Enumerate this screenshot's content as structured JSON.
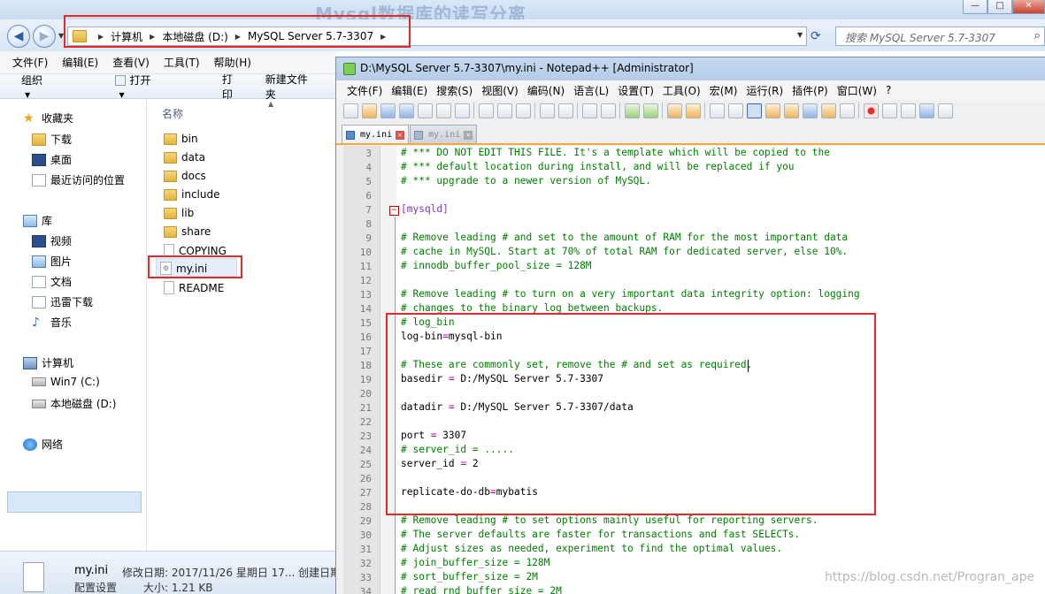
{
  "explorer": {
    "bg_title": "Mysql数据库的读写分离",
    "window_buttons": [
      "—",
      "□",
      "✕"
    ],
    "back_icon": "◀",
    "forward_icon": "▶",
    "breadcrumb": [
      "计算机",
      "本地磁盘 (D:)",
      "MySQL Server 5.7-3307"
    ],
    "search_placeholder": "搜索 MySQL Server 5.7-3307",
    "menu": [
      "文件(F)",
      "编辑(E)",
      "查看(V)",
      "工具(T)",
      "帮助(H)"
    ],
    "commands": [
      "组织",
      "打开",
      "打印",
      "新建文件夹"
    ],
    "nav": {
      "favorites": "收藏夹",
      "fav_items": [
        "下载",
        "桌面",
        "最近访问的位置"
      ],
      "library": "库",
      "lib_items": [
        "视频",
        "图片",
        "文档",
        "迅雷下载",
        "音乐"
      ],
      "computer": "计算机",
      "comp_items": [
        "Win7 (C:)",
        "本地磁盘 (D:)"
      ],
      "network": "网络"
    },
    "column_header": "名称",
    "folders": [
      "bin",
      "data",
      "docs",
      "include",
      "lib",
      "share"
    ],
    "files": [
      "COPYING",
      "my.ini",
      "README"
    ],
    "details": {
      "name": "my.ini",
      "type": "配置设置",
      "modified": "修改日期: 2017/11/26 星期日 17... 创建日期",
      "size": "大小: 1.21 KB"
    }
  },
  "npp": {
    "title": "D:\\MySQL Server 5.7-3307\\my.ini - Notepad++ [Administrator]",
    "menu": [
      "文件(F)",
      "编辑(E)",
      "搜索(S)",
      "视图(V)",
      "编码(N)",
      "语言(L)",
      "设置(T)",
      "工具(O)",
      "宏(M)",
      "运行(R)",
      "插件(P)",
      "窗口(W)",
      "?"
    ],
    "tabs": [
      {
        "label": "my.ini",
        "close": "✕"
      },
      {
        "label": "my.ini",
        "close": "✕"
      }
    ],
    "fold_marker": "−",
    "lines": [
      {
        "n": "3",
        "text": "# *** DO NOT EDIT THIS FILE. It's a template which will be copied to the",
        "kind": "com"
      },
      {
        "n": "4",
        "text": "# *** default location during install, and will be replaced if you",
        "kind": "com"
      },
      {
        "n": "5",
        "text": "# *** upgrade to a newer version of MySQL.",
        "kind": "com"
      },
      {
        "n": "6",
        "text": "",
        "kind": "key"
      },
      {
        "n": "7",
        "text": "[mysqld]",
        "kind": "sec"
      },
      {
        "n": "8",
        "text": "",
        "kind": "key"
      },
      {
        "n": "9",
        "text": "# Remove leading # and set to the amount of RAM for the most important data",
        "kind": "com"
      },
      {
        "n": "10",
        "text": "# cache in MySQL. Start at 70% of total RAM for dedicated server, else 10%.",
        "kind": "com"
      },
      {
        "n": "11",
        "text": "# innodb_buffer_pool_size = 128M",
        "kind": "com"
      },
      {
        "n": "12",
        "text": "",
        "kind": "key"
      },
      {
        "n": "13",
        "text": "# Remove leading # to turn on a very important data integrity option: logging",
        "kind": "com"
      },
      {
        "n": "14",
        "text": "# changes to the binary log between backups.",
        "kind": "com"
      },
      {
        "n": "15",
        "text": "# log_bin",
        "kind": "com"
      },
      {
        "n": "16",
        "text": "log-bin=mysql-bin",
        "kind": "kv"
      },
      {
        "n": "17",
        "text": "",
        "kind": "key"
      },
      {
        "n": "18",
        "text": "# These are commonly set, remove the # and set as required.",
        "kind": "com"
      },
      {
        "n": "19",
        "text": "basedir = D:/MySQL Server 5.7-3307",
        "kind": "kv"
      },
      {
        "n": "20",
        "text": "",
        "kind": "key"
      },
      {
        "n": "21",
        "text": "datadir = D:/MySQL Server 5.7-3307/data",
        "kind": "kv"
      },
      {
        "n": "22",
        "text": "",
        "kind": "key"
      },
      {
        "n": "23",
        "text": "port = 3307",
        "kind": "kv"
      },
      {
        "n": "24",
        "text": "# server_id = .....",
        "kind": "com"
      },
      {
        "n": "25",
        "text": "server_id = 2",
        "kind": "kv"
      },
      {
        "n": "26",
        "text": "",
        "kind": "key"
      },
      {
        "n": "27",
        "text": "replicate-do-db=mybatis",
        "kind": "kv"
      },
      {
        "n": "28",
        "text": "",
        "kind": "key"
      },
      {
        "n": "29",
        "text": "# Remove leading # to set options mainly useful for reporting servers.",
        "kind": "com"
      },
      {
        "n": "30",
        "text": "# The server defaults are faster for transactions and fast SELECTs.",
        "kind": "com"
      },
      {
        "n": "31",
        "text": "# Adjust sizes as needed, experiment to find the optimal values.",
        "kind": "com"
      },
      {
        "n": "32",
        "text": "# join_buffer_size = 128M",
        "kind": "com"
      },
      {
        "n": "33",
        "text": "# sort_buffer_size = 2M",
        "kind": "com"
      },
      {
        "n": "34",
        "text": "# read_rnd_buffer_size = 2M",
        "kind": "com"
      }
    ]
  },
  "watermark": "https://blog.csdn.net/Progran_ape"
}
